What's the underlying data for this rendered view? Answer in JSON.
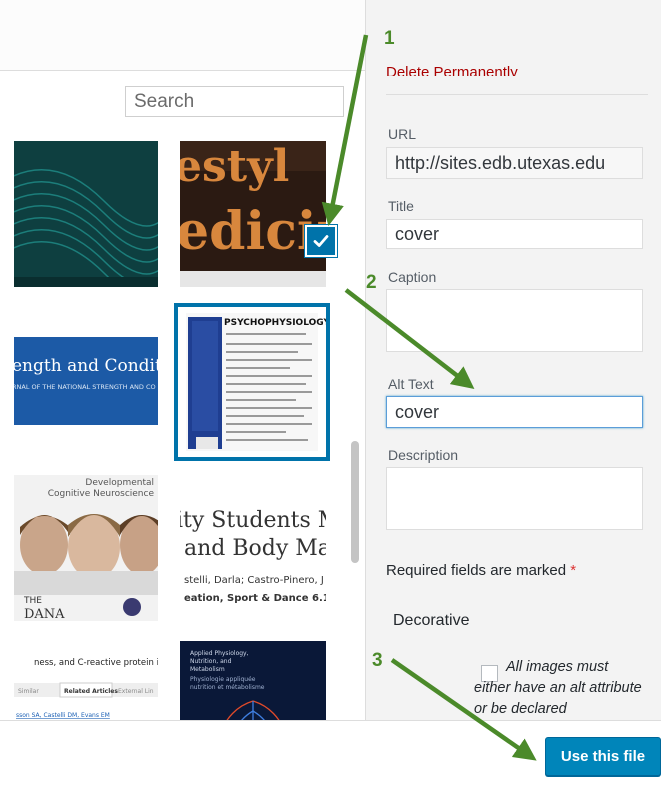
{
  "search": {
    "placeholder": "Search"
  },
  "thumbnails": {
    "t2_text": "lestyl edicir",
    "t3_text": "ength and Condition",
    "t3_sub": "RNAL OF THE NATIONAL STRENGTH AND CO",
    "t4_title": "PSYCHOPHYSIOLOGY",
    "t5_header": "Developmental Cognitive Neuroscience",
    "t5_footer": "THE DANA",
    "t6_line1": "ity Students M",
    "t6_line2": "and Body Ma",
    "t6_line3": "stelli, Darla; Castro-Pinero, J",
    "t6_line4": "eation, Sport & Dance 6.1 (S",
    "t7_line1": "ness, and C-reactive protein in childr",
    "t7_tab1": "Similar",
    "t7_tab2": "Related Articles",
    "t7_tab3": "External Lin",
    "t7_authors": "sson SA, Castelli DM, Evans EM",
    "t7_affil": "ommunity Health, University of Illinois at Urbana-Cha",
    "t7_journal": "nd Exercise [2010, 42(11):1981-1986]",
    "t7_support": "pport, Non-U.S. Gov't",
    "t7_cite": "title",
    "t8_header": "Applied Physiology, Nutrition, and Metabolism",
    "t8_sub": "Physiologie appliquée nutrition et métabolisme"
  },
  "sidebar": {
    "delete_link": "Delete Permanently",
    "url_label": "URL",
    "url_value": "http://sites.edb.utexas.edu",
    "title_label": "Title",
    "title_value": "cover",
    "caption_label": "Caption",
    "alt_label": "Alt Text",
    "alt_value": "cover",
    "description_label": "Description",
    "required_note": "Required fields are marked",
    "required_star": "*",
    "decorative_label": "Decorative",
    "decorative_help": "All images must either have an alt attribute or be declared"
  },
  "footer": {
    "use_button": "Use this file"
  },
  "annotations": {
    "n1": "1",
    "n2": "2",
    "n3": "3"
  },
  "colors": {
    "accent": "#0073aa",
    "button": "#0085ba",
    "arrow": "#4b8a2a",
    "danger": "#a00000"
  }
}
